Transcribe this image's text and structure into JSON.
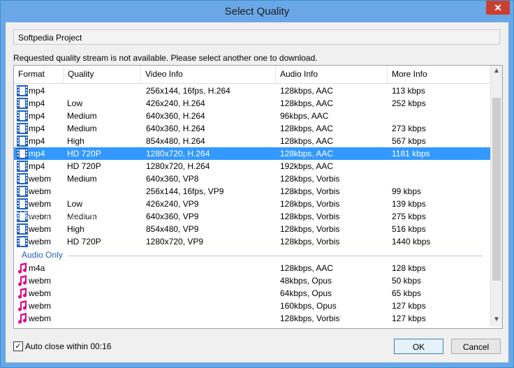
{
  "window": {
    "title": "Select Quality",
    "close_glyph": "✕"
  },
  "project": {
    "name": "Softpedia Project"
  },
  "message": "Requested quality stream is not available. Please select another one to download.",
  "columns": [
    "Format",
    "Quality",
    "Video Info",
    "Audio Info",
    "More Info"
  ],
  "video_rows": [
    {
      "format": "mp4",
      "quality": "",
      "video": "256x144, 16fps, H.264",
      "audio": "128kbps, AAC",
      "more": "113 kbps",
      "icon": "video-icon"
    },
    {
      "format": "mp4",
      "quality": "Low",
      "video": "426x240, H.264",
      "audio": "128kbps, AAC",
      "more": "252 kbps",
      "icon": "video-icon"
    },
    {
      "format": "mp4",
      "quality": "Medium",
      "video": "640x360, H.264",
      "audio": "96kbps, AAC",
      "more": "",
      "icon": "video-icon"
    },
    {
      "format": "mp4",
      "quality": "Medium",
      "video": "640x360, H.264",
      "audio": "128kbps, AAC",
      "more": "273 kbps",
      "icon": "video-icon"
    },
    {
      "format": "mp4",
      "quality": "High",
      "video": "854x480, H.264",
      "audio": "128kbps, AAC",
      "more": "567 kbps",
      "icon": "video-icon"
    },
    {
      "format": "mp4",
      "quality": "HD 720P",
      "video": "1280x720, H.264",
      "audio": "128kbps, AAC",
      "more": "1181 kbps",
      "icon": "video-icon",
      "selected": true
    },
    {
      "format": "mp4",
      "quality": "HD 720P",
      "video": "1280x720, H.264",
      "audio": "192kbps, AAC",
      "more": "",
      "icon": "video-icon"
    },
    {
      "format": "webm",
      "quality": "Medium",
      "video": "640x360, VP8",
      "audio": "128kbps, Vorbis",
      "more": "",
      "icon": "video-icon"
    },
    {
      "format": "webm",
      "quality": "",
      "video": "256x144, 16fps, VP9",
      "audio": "128kbps, Vorbis",
      "more": "99 kbps",
      "icon": "video-icon"
    },
    {
      "format": "webm",
      "quality": "Low",
      "video": "426x240, VP9",
      "audio": "128kbps, Vorbis",
      "more": "139 kbps",
      "icon": "video-icon"
    },
    {
      "format": "webm",
      "quality": "Medium",
      "video": "640x360, VP9",
      "audio": "128kbps, Vorbis",
      "more": "275 kbps",
      "icon": "video-icon"
    },
    {
      "format": "webm",
      "quality": "High",
      "video": "854x480, VP9",
      "audio": "128kbps, Vorbis",
      "more": "516 kbps",
      "icon": "video-icon"
    },
    {
      "format": "webm",
      "quality": "HD 720P",
      "video": "1280x720, VP9",
      "audio": "128kbps, Vorbis",
      "more": "1440 kbps",
      "icon": "video-icon"
    }
  ],
  "audio_section": {
    "label": "Audio Only"
  },
  "audio_rows": [
    {
      "format": "m4a",
      "quality": "",
      "video": "",
      "audio": "128kbps, AAC",
      "more": "128 kbps",
      "icon": "music-note-icon"
    },
    {
      "format": "webm",
      "quality": "",
      "video": "",
      "audio": "48kbps, Opus",
      "more": "50 kbps",
      "icon": "music-note-icon"
    },
    {
      "format": "webm",
      "quality": "",
      "video": "",
      "audio": "64kbps, Opus",
      "more": "65 kbps",
      "icon": "music-note-icon"
    },
    {
      "format": "webm",
      "quality": "",
      "video": "",
      "audio": "160kbps, Opus",
      "more": "127 kbps",
      "icon": "music-note-icon"
    },
    {
      "format": "webm",
      "quality": "",
      "video": "",
      "audio": "128kbps, Vorbis",
      "more": "127 kbps",
      "icon": "music-note-icon"
    }
  ],
  "watermark": "SOFTPEDIA",
  "footer": {
    "auto_close_label": "Auto close within 00:16",
    "auto_close_checked": true,
    "check_glyph": "✓",
    "ok_label": "OK",
    "cancel_label": "Cancel"
  },
  "scrollbar": {
    "up_glyph": "▲",
    "down_glyph": "▼"
  },
  "colors": {
    "accent": "#3399ff",
    "title_bar": "#6aa7e6",
    "close_button": "#c84031",
    "audio_icon": "#e0008a",
    "video_icon": "#1f5fbf"
  }
}
